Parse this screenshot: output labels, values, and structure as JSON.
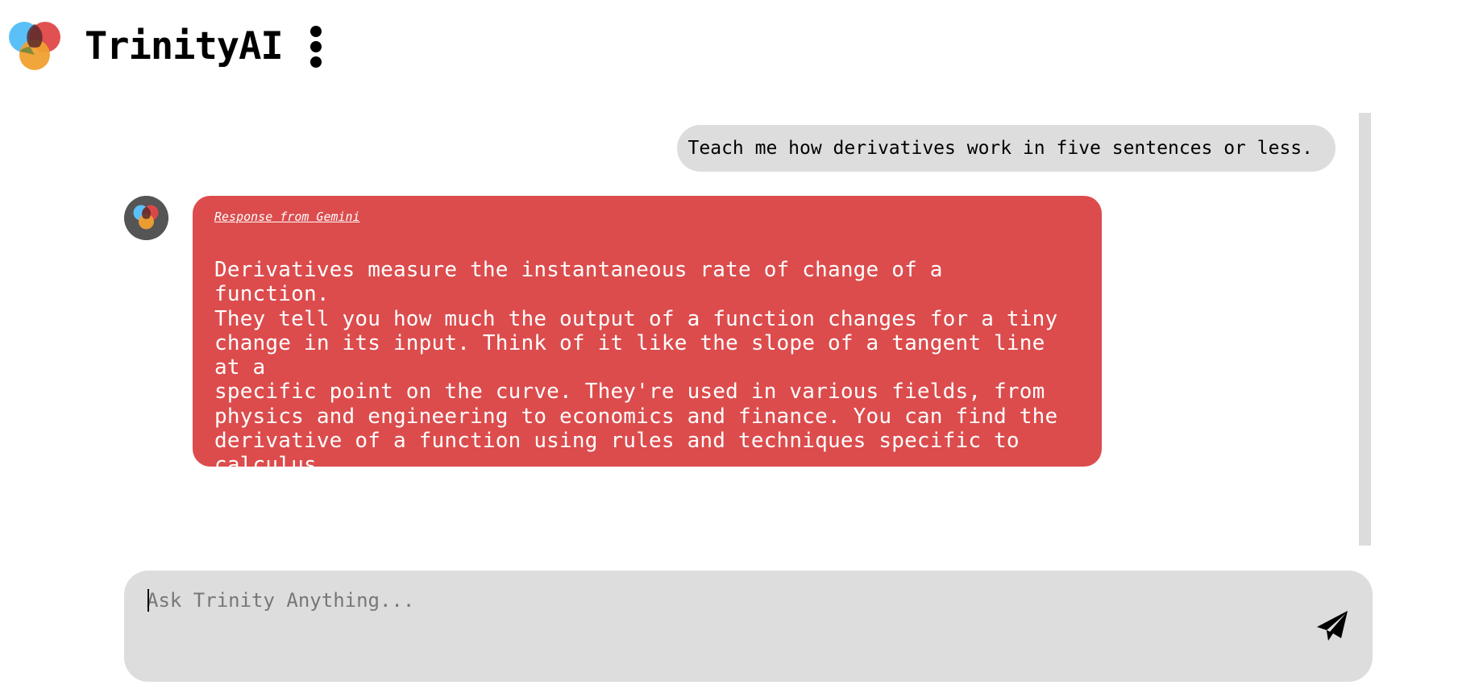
{
  "app": {
    "title": "TrinityAI"
  },
  "icons": {
    "logo": "trinity-logo-icon",
    "menu": "vertical-ellipsis-icon",
    "avatar": "trinity-avatar-icon",
    "send": "paper-plane-icon"
  },
  "colors": {
    "logo_blue": "#5bc0f8",
    "logo_red": "#e04848",
    "logo_orange": "#f0a030",
    "bot_bubble": "#dc4c4d",
    "user_bubble": "#dddddd",
    "input_bg": "#dddddd",
    "scrollbar": "#dcdcdc"
  },
  "chat": {
    "messages": [
      {
        "role": "user",
        "text": "Teach me how derivatives work in five sentences or less."
      },
      {
        "role": "assistant",
        "source_label": "Response from Gemini",
        "text": "Derivatives measure the instantaneous rate of change of a function.\nThey tell you how much the output of a function changes for a tiny\nchange in its input. Think of it like the slope of a tangent line at a\nspecific point on the curve. They're used in various fields, from\nphysics and engineering to economics and finance. You can find the\nderivative of a function using rules and techniques specific to\ncalculus."
      }
    ]
  },
  "composer": {
    "placeholder": "Ask Trinity Anything...",
    "value": ""
  }
}
